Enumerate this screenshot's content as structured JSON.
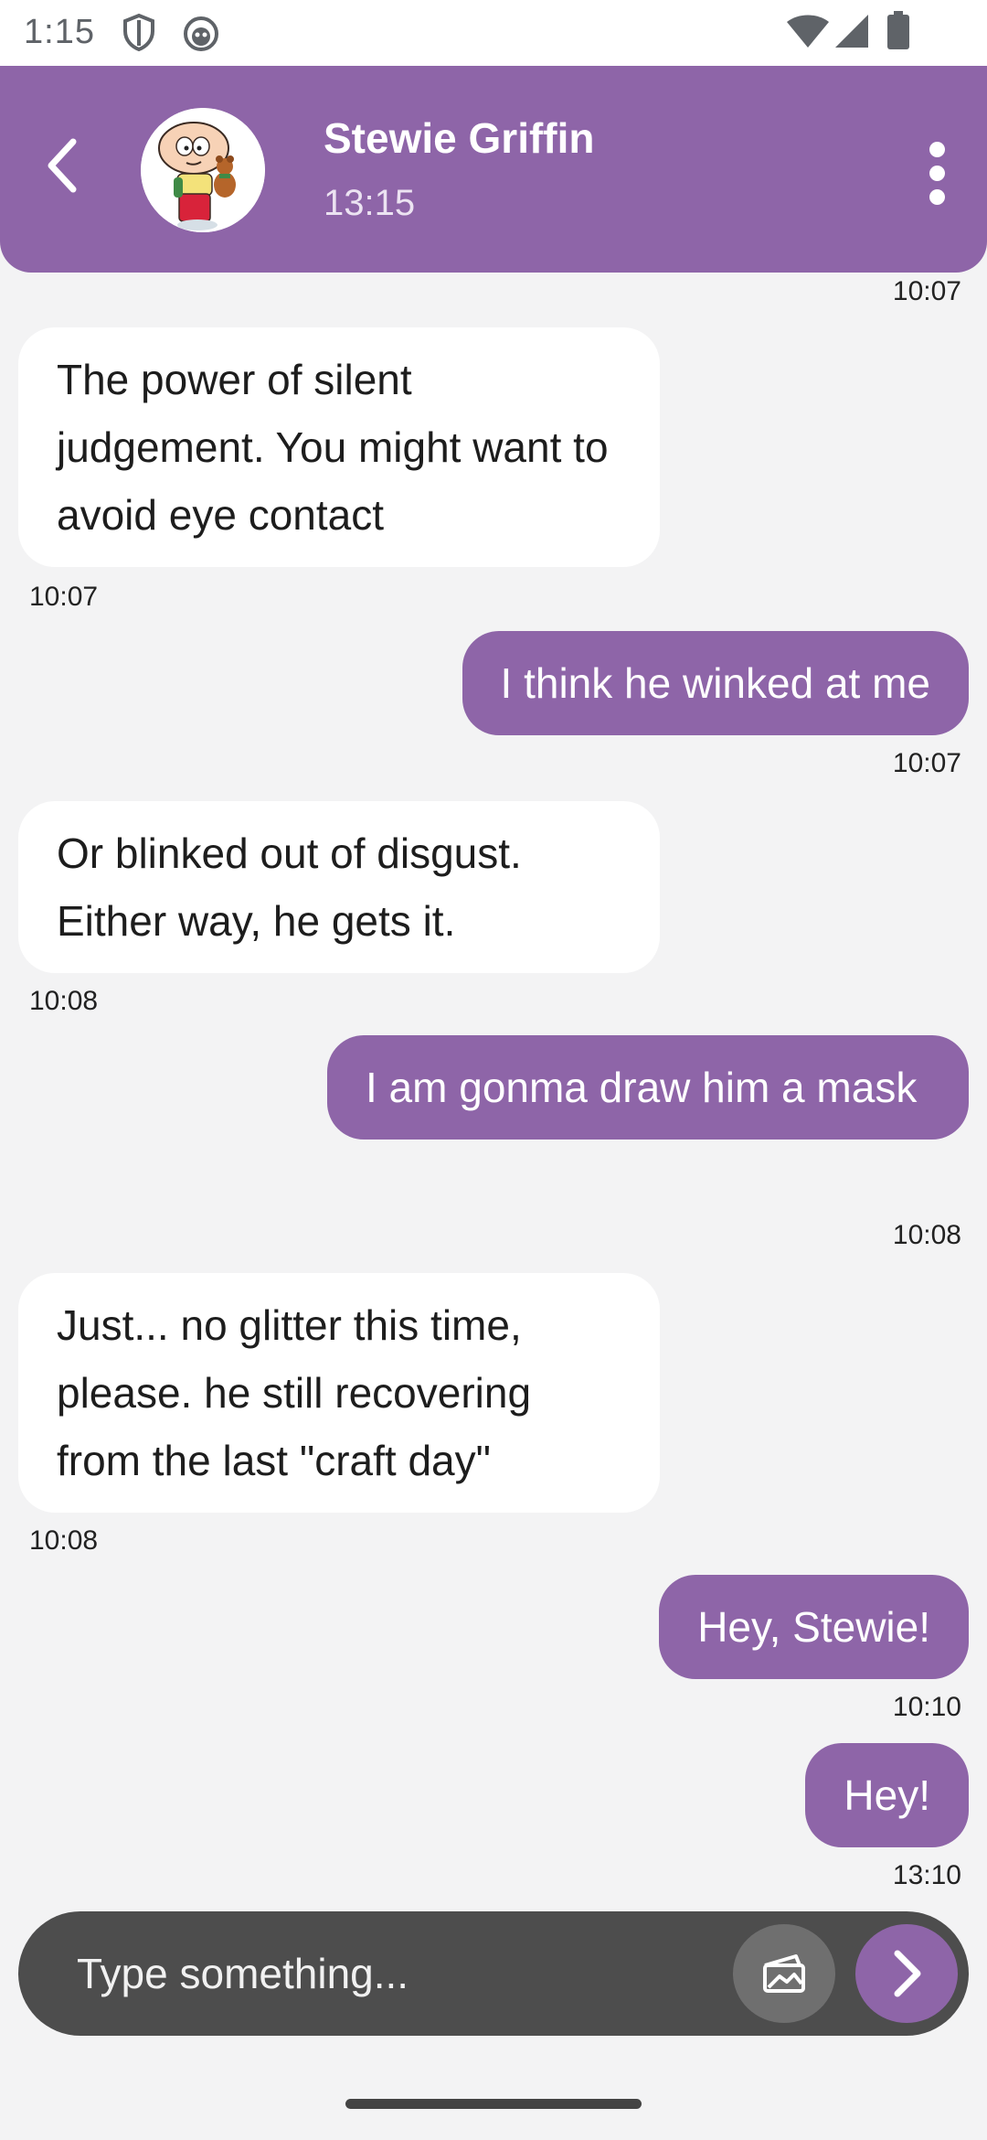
{
  "status_bar": {
    "time": "1:15",
    "icons": [
      "shield-icon",
      "app-face-icon",
      "wifi-icon",
      "signal-icon",
      "battery-icon"
    ]
  },
  "header": {
    "contact_name": "Stewie Griffin",
    "contact_status": "13:15",
    "back_icon": "chevron-left-icon",
    "menu_icon": "more-vert-icon",
    "background_color": "#8e65a8"
  },
  "messages": {
    "top_timestamp": "10:07",
    "items": [
      {
        "sender": "contact",
        "text": "The power of silent judgement. You might want to avoid eye contact",
        "time": "10:07"
      },
      {
        "sender": "me",
        "text": "I think he winked at me",
        "time": "10:07"
      },
      {
        "sender": "contact",
        "text": "Or blinked out of disgust. Either way, he gets it.",
        "time": "10:08"
      },
      {
        "sender": "me",
        "text": "I am gonma draw him a mask",
        "time": "10:08"
      },
      {
        "sender": "contact",
        "text": "Just... no glitter this time, please. he still recovering from the last \"craft day\"",
        "time": "10:08"
      },
      {
        "sender": "me",
        "text": "Hey, Stewie!",
        "time": "10:10"
      },
      {
        "sender": "me",
        "text": "Hey!",
        "time": "13:10"
      }
    ]
  },
  "composer": {
    "placeholder": "Type something...",
    "attach_icon": "image-attach-icon",
    "send_icon": "send-chevron-icon"
  },
  "colors": {
    "accent": "#8e65a8",
    "chat_background": "#f3f3f4",
    "incoming_bubble": "#ffffff",
    "composer": "#4d4d4d"
  }
}
